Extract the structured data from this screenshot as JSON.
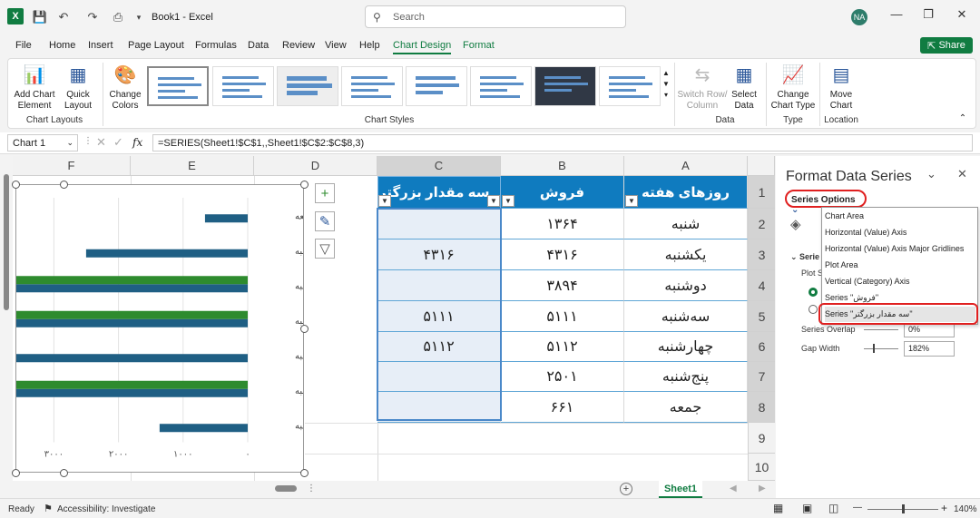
{
  "app": {
    "title": "Book1 - Excel",
    "logo": "X",
    "user_initials": "NA",
    "search_placeholder": "Search",
    "share_label": "Share"
  },
  "menu": [
    "File",
    "Home",
    "Insert",
    "Page Layout",
    "Formulas",
    "Data",
    "Review",
    "View",
    "Help",
    "Chart Design",
    "Format"
  ],
  "ribbon": {
    "add_chart_element": [
      "Add Chart",
      "Element"
    ],
    "quick_layout": [
      "Quick",
      "Layout"
    ],
    "change_colors": [
      "Change",
      "Colors"
    ],
    "switch_row_column": [
      "Switch Row/",
      "Column"
    ],
    "select_data": [
      "Select",
      "Data"
    ],
    "change_chart_type": [
      "Change",
      "Chart Type"
    ],
    "move_chart": [
      "Move",
      "Chart"
    ],
    "groups": {
      "chart_layouts": "Chart Layouts",
      "chart_styles": "Chart Styles",
      "data": "Data",
      "type": "Type",
      "location": "Location"
    }
  },
  "formula_bar": {
    "name_box": "Chart 1",
    "formula": "=SERIES(Sheet1!$C$1,,Sheet1!$C$2:$C$8,3)",
    "fx": "fx"
  },
  "columns": [
    "F",
    "E",
    "D",
    "C",
    "B",
    "A"
  ],
  "rows": [
    "1",
    "2",
    "3",
    "4",
    "5",
    "6",
    "7",
    "8",
    "9",
    "10"
  ],
  "table": {
    "headers": {
      "A": "روزهای هفته",
      "B": "فروش",
      "C": "سه مقدار بزرگتر"
    },
    "A": [
      "شنبه",
      "یکشنبه",
      "دوشنبه",
      "سه‌شنبه",
      "چهارشنبه",
      "پنج‌شنبه",
      "جمعه"
    ],
    "B": [
      "۱۳۶۴",
      "۴۳۱۶",
      "۳۸۹۴",
      "۵۱۱۱",
      "۵۱۱۲",
      "۲۵۰۱",
      "۶۶۱"
    ],
    "C": [
      "",
      "۴۳۱۶",
      "",
      "۵۱۱۱",
      "۵۱۱۲",
      "",
      ""
    ]
  },
  "chart_data": {
    "type": "bar",
    "orientation": "horizontal",
    "reversed_value_axis": true,
    "categories": [
      "جمعه",
      "پنج‌شنبه",
      "چهارشنبه",
      "سه‌شنبه",
      "دوشنبه",
      "یکشنبه",
      "شنبه"
    ],
    "series": [
      {
        "name": "فروش",
        "color": "#1f5f84",
        "values": [
          661,
          2501,
          5112,
          5111,
          3894,
          4316,
          1364
        ]
      },
      {
        "name": "سه مقدار بزرگتر",
        "color": "#2e8b2e",
        "values": [
          0,
          0,
          5112,
          5111,
          0,
          4316,
          0
        ]
      }
    ],
    "xticks": [
      "۳۰۰۰",
      "۲۰۰۰",
      "۱۰۰۰",
      "۰"
    ],
    "xlim": [
      0,
      3300
    ],
    "grid": true
  },
  "pane": {
    "title": "Format Data Series",
    "series_options_label": "Series Options",
    "dropdown": [
      "Chart Area",
      "Horizontal (Value) Axis",
      "Horizontal (Value) Axis Major Gridlines",
      "Plot Area",
      "Vertical (Category) Axis",
      "Series \"فروش\"",
      "Series \"سه مقدار بزرگتر\""
    ],
    "series_overlap_label": "Series Overlap",
    "series_overlap_value": "0%",
    "gap_width_label": "Gap Width",
    "gap_width_value": "182%",
    "plot_label": "Plot S",
    "series_label": "Serie"
  },
  "status": {
    "ready": "Ready",
    "accessibility": "Accessibility: Investigate",
    "zoom": "140%",
    "sheet": "Sheet1"
  }
}
